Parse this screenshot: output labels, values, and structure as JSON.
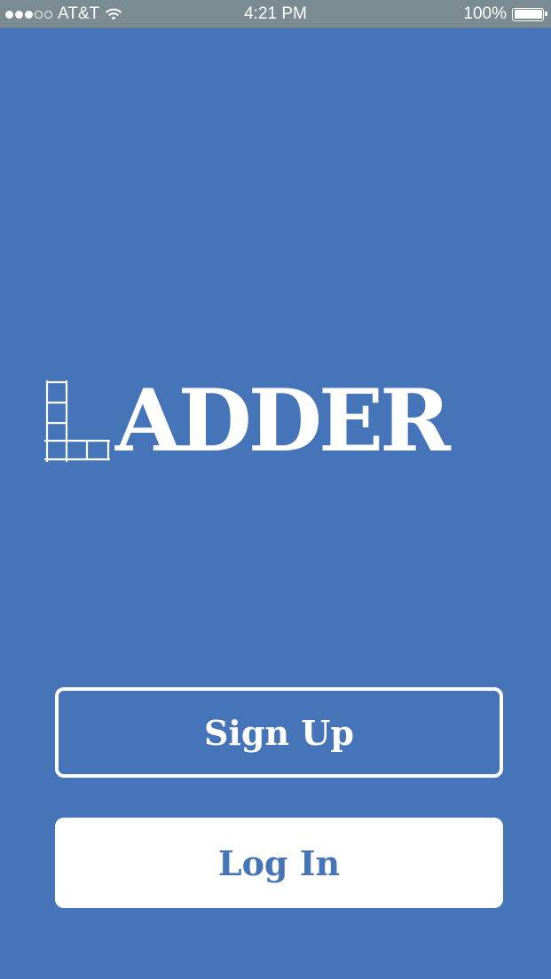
{
  "status_bar": {
    "carrier": "AT&T",
    "time": "4:21 PM",
    "battery_percent": "100%",
    "battery_level": 1.0,
    "signal_bars": 3,
    "signal_total": 5,
    "wifi_icon": "wifi-icon"
  },
  "logo": {
    "text": "ADDER",
    "icon": "ladder-icon"
  },
  "actions": {
    "signup_label": "Sign Up",
    "login_label": "Log In"
  },
  "colors": {
    "background": "#4574b8",
    "status_bar": "#7a8c92",
    "foreground": "#ffffff"
  }
}
